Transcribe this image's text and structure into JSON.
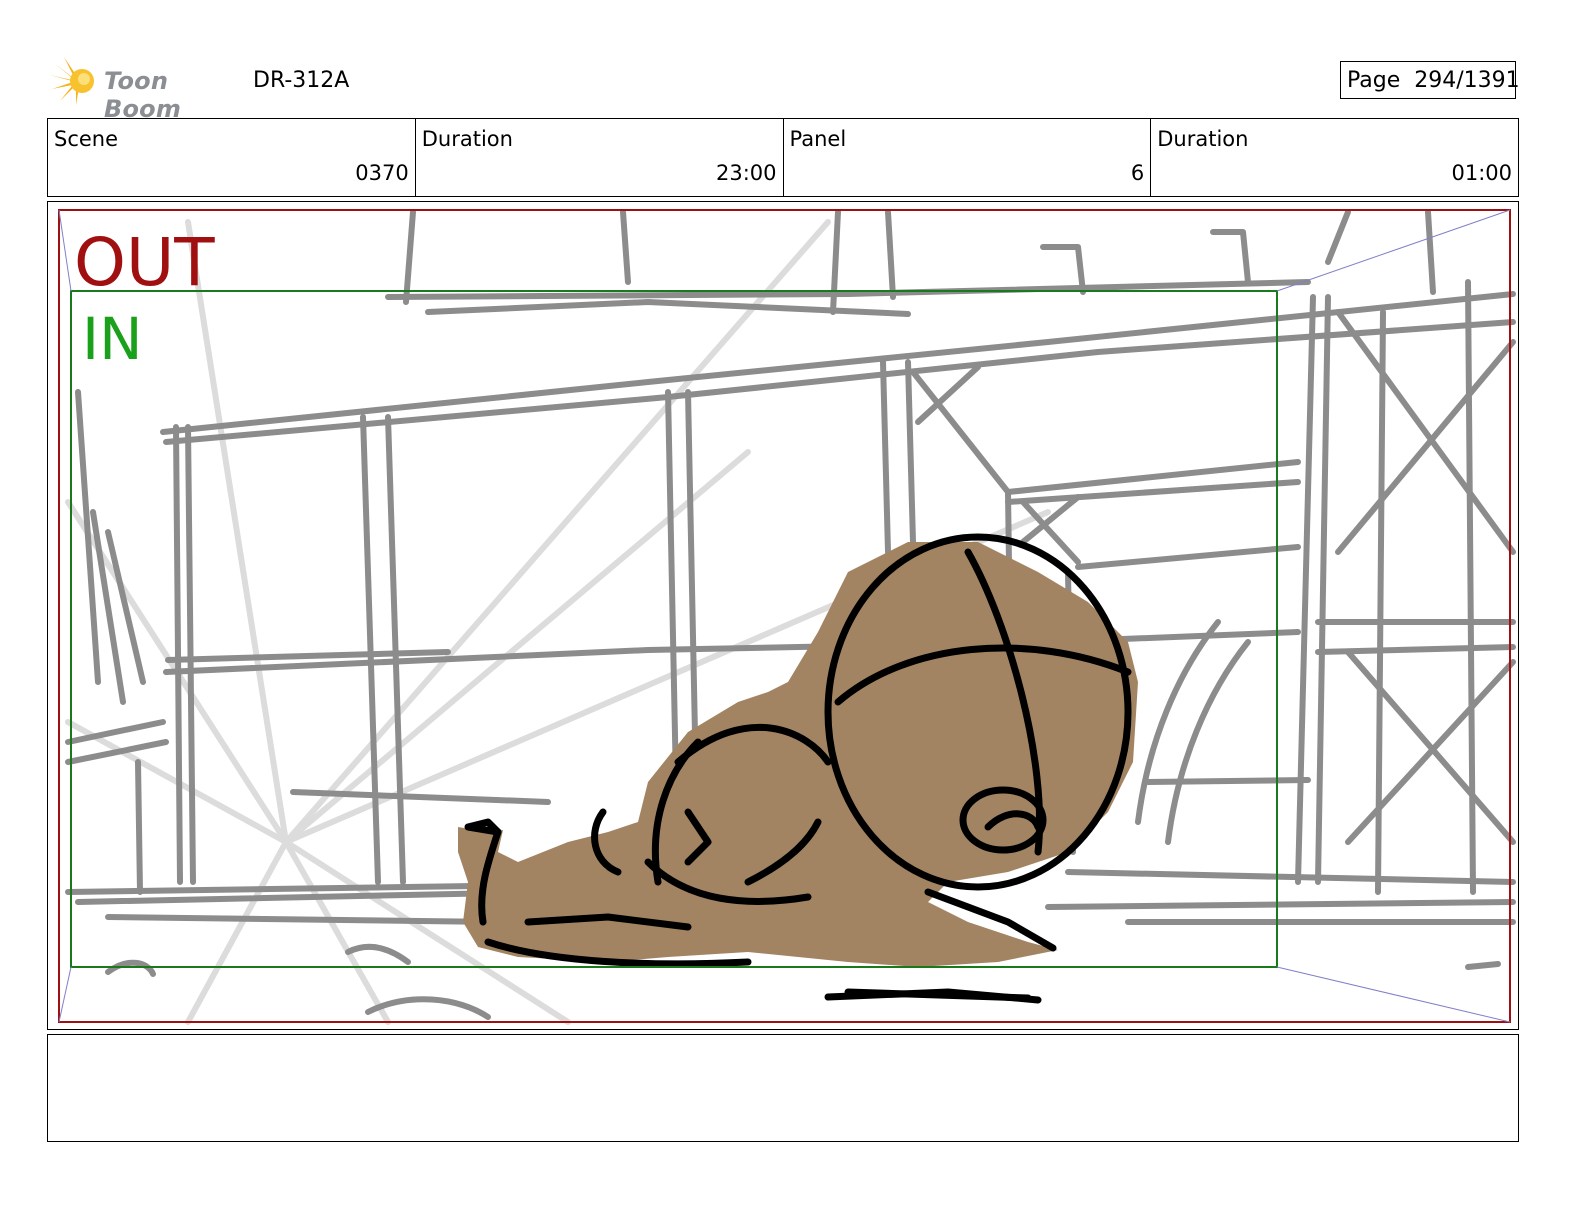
{
  "header": {
    "brand": "Toon Boom",
    "project_code": "DR-312A",
    "page_label": "Page",
    "page_value": "294/1391"
  },
  "info": {
    "scene_label": "Scene",
    "scene_value": "0370",
    "scene_duration_label": "Duration",
    "scene_duration_value": "23:00",
    "panel_label": "Panel",
    "panel_value": "6",
    "panel_duration_label": "Duration",
    "panel_duration_value": "01:00"
  },
  "panel_art": {
    "out_label": "OUT",
    "in_label": "IN",
    "out_frame_color": "#a01010",
    "in_frame_color": "#1a7a1a",
    "sketch_color": "#8c8c8c",
    "character_fill": "#a38462"
  },
  "notes": {
    "text": ""
  }
}
